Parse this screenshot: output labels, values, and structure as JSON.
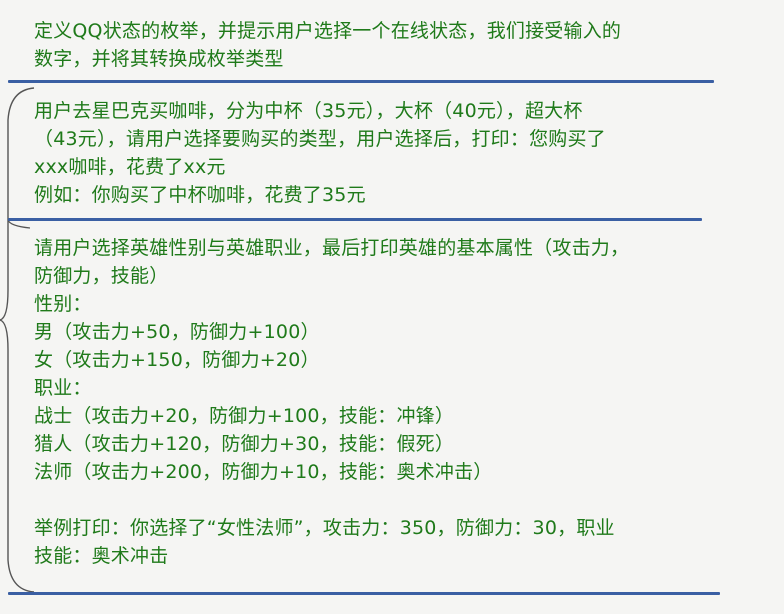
{
  "blocks": [
    {
      "id": "enum-qq-status",
      "lines": [
        "定义QQ状态的枚举，并提示用户选择一个在线状态，我们接受输入的",
        "数字，并将其转换成枚举类型"
      ]
    },
    {
      "id": "starbucks",
      "lines": [
        "用户去星巴克买咖啡，分为中杯（35元），大杯（40元），超大杯",
        "（43元），请用户选择要购买的类型，用户选择后，打印：您购买了",
        "xxx咖啡，花费了xx元",
        "例如：你购买了中杯咖啡，花费了35元"
      ]
    },
    {
      "id": "hero",
      "lines": [
        "请用户选择英雄性别与英雄职业，最后打印英雄的基本属性（攻击力，",
        "防御力，技能）",
        "性别：",
        "男（攻击力+50，防御力+100）",
        "女（攻击力+150，防御力+20）",
        "职业：",
        "战士（攻击力+20，防御力+100，技能：冲锋）",
        "猎人（攻击力+120，防御力+30，技能：假死）",
        "法师（攻击力+200，防御力+10，技能：奥术冲击）",
        "",
        "举例打印：你选择了“女性法师”，攻击力：350，防御力：30，职业",
        "技能：奥术冲击"
      ]
    }
  ],
  "colors": {
    "text": "#1f7a1a",
    "divider": "#3a5fa3",
    "bracket": "#555555",
    "background": "#f5f5f3"
  }
}
